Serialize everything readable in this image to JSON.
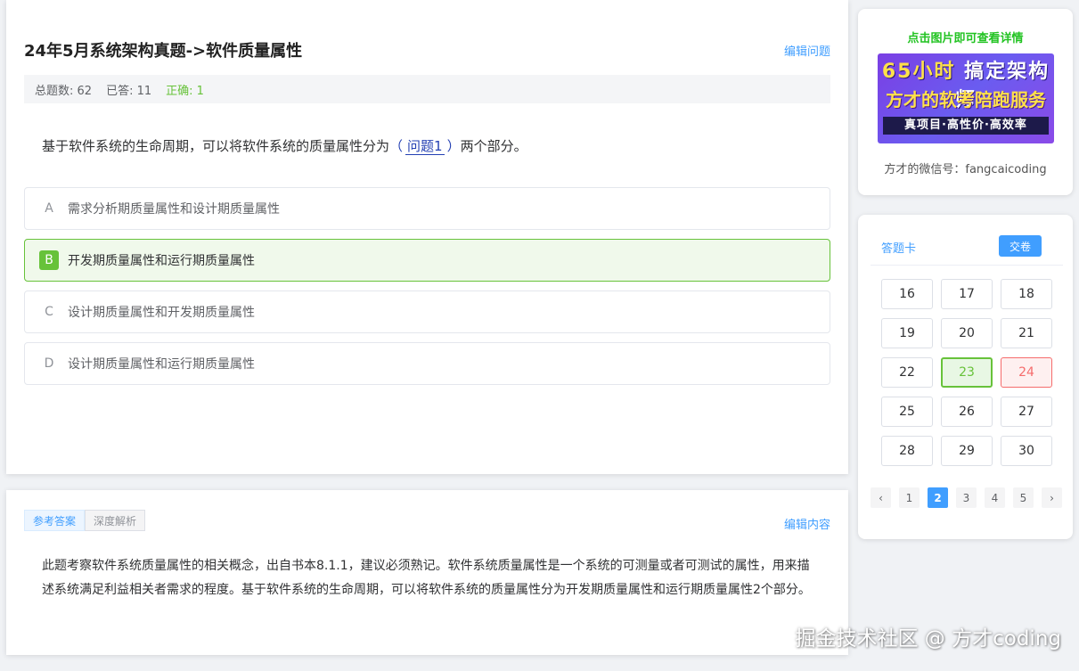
{
  "question": {
    "title": "24年5月系统架构真题->软件质量属性",
    "edit_label": "编辑问题",
    "stats": {
      "total": "总题数: 62",
      "answered": "已答: 11",
      "correct": "正确: 1"
    },
    "text_before": "基于软件系统的生命周期，可以将软件系统的质量属性分为",
    "blank_open": "（",
    "blank_label": "问题1",
    "blank_close": "）",
    "text_after": "两个部分。",
    "options": [
      {
        "letter": "A",
        "text": "需求分析期质量属性和设计期质量属性"
      },
      {
        "letter": "B",
        "text": "开发期质量属性和运行期质量属性"
      },
      {
        "letter": "C",
        "text": "设计期质量属性和开发期质量属性"
      },
      {
        "letter": "D",
        "text": "设计期质量属性和运行期质量属性"
      }
    ]
  },
  "analysis": {
    "tabs": [
      "参考答案",
      "深度解析"
    ],
    "edit_label": "编辑内容",
    "text": "此题考察软件系统质量属性的相关概念，出自书本8.1.1，建议必须熟记。软件系统质量属性是一个系统的可测量或者可测试的属性，用来描述系统满足利益相关者需求的程度。基于软件系统的生命周期，可以将软件系统的质量属性分为开发期质量属性和运行期质量属性2个部分。"
  },
  "promo": {
    "title": "点击图片即可查看详情",
    "banner_hours": "65小时",
    "banner_line1": "搞定架构师",
    "banner_line2": "方才的软考陪跑服务",
    "banner_line3": "真项目·高性价·高效率",
    "wechat": "方才的微信号：fangcaicoding"
  },
  "answer_card": {
    "title": "答题卡",
    "submit_label": "交卷",
    "numbers": [
      "16",
      "17",
      "18",
      "19",
      "20",
      "21",
      "22",
      "23",
      "24",
      "25",
      "26",
      "27",
      "28",
      "29",
      "30"
    ],
    "states": {
      "23": "correct",
      "24": "wrong"
    },
    "pager": {
      "prev": "‹",
      "pages": [
        "1",
        "2",
        "3",
        "4",
        "5"
      ],
      "current": "2",
      "next": "›"
    }
  },
  "watermark": "掘金技术社区 @ 方才coding",
  "colors": {
    "accent": "#409eff",
    "correct": "#67c23a",
    "wrong": "#f56c6c"
  }
}
